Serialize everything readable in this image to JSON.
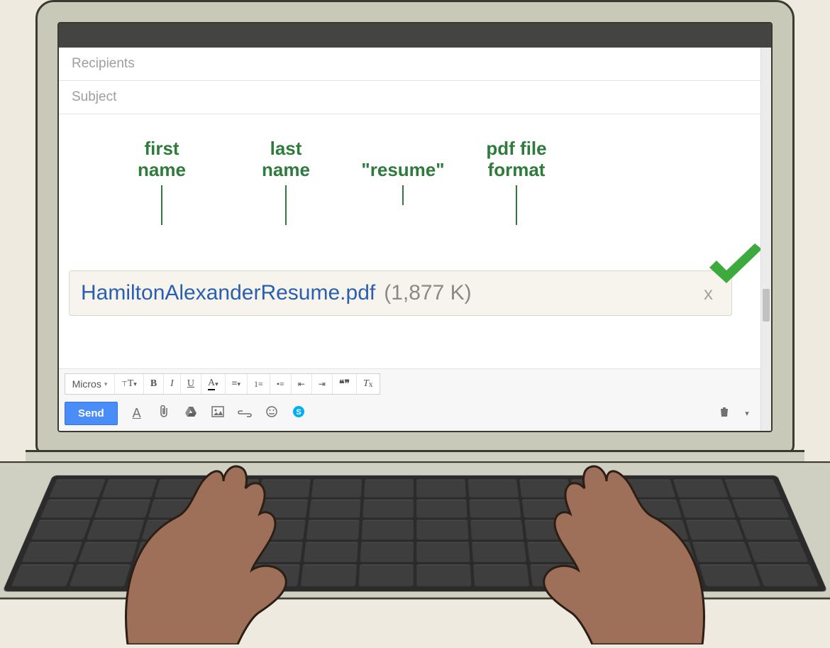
{
  "compose": {
    "recipients_placeholder": "Recipients",
    "subject_placeholder": "Subject"
  },
  "annotations": {
    "first_name_l1": "first",
    "first_name_l2": "name",
    "last_name_l1": "last",
    "last_name_l2": "name",
    "resume": "\"resume\"",
    "pdf_l1": "pdf file",
    "pdf_l2": "format"
  },
  "attachment": {
    "filename": "HamiltonAlexanderResume.pdf",
    "filesize": "(1,877 K)",
    "remove": "x"
  },
  "toolbar": {
    "font_name": "Micros",
    "send": "Send"
  }
}
